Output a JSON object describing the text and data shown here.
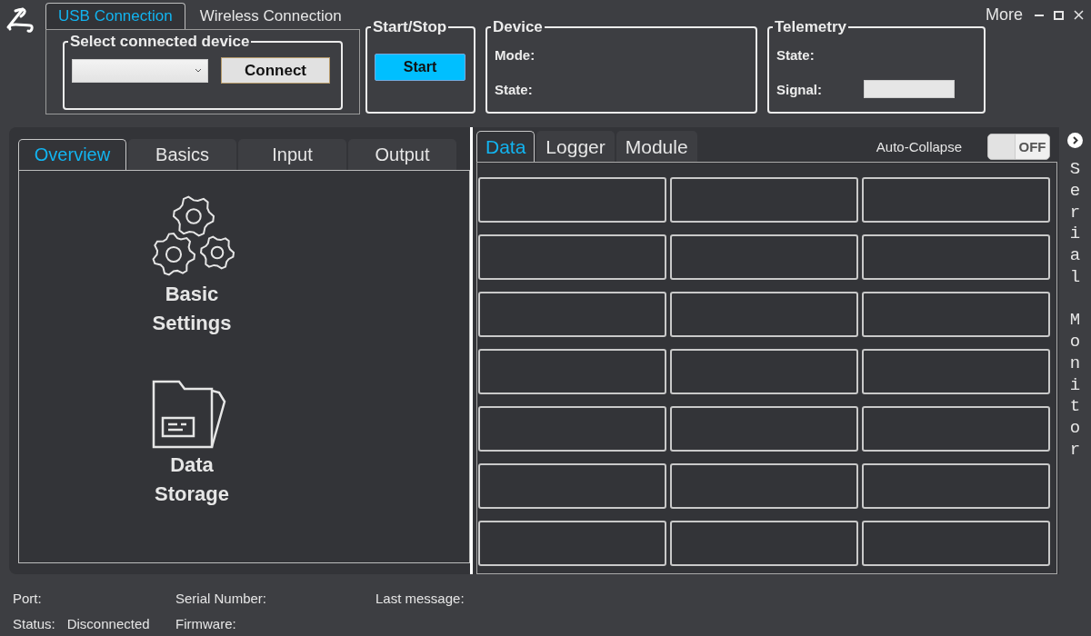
{
  "app_tabs": [
    {
      "label": "USB Connection",
      "selected": true
    },
    {
      "label": "Wireless Connection",
      "selected": false
    }
  ],
  "connect_group": {
    "title": "Select connected device",
    "button": "Connect"
  },
  "start_group": {
    "title": "Start/Stop",
    "button": "Start"
  },
  "device_group": {
    "title": "Device",
    "fields": [
      {
        "label": "Mode:"
      },
      {
        "label": "State:"
      }
    ]
  },
  "telemetry_group": {
    "title": "Telemetry",
    "state_label": "State:",
    "signal": {
      "label": "Signal:"
    }
  },
  "more_menu": "More",
  "settings_tabs": [
    {
      "label": "Overview",
      "selected": true
    },
    {
      "label": "Basics",
      "selected": false
    },
    {
      "label": "Input",
      "selected": false
    },
    {
      "label": "Output",
      "selected": false
    }
  ],
  "overview_items": [
    {
      "kind": "settings",
      "label": "Basic Settings"
    },
    {
      "kind": "storage",
      "label": "Data Storage"
    }
  ],
  "data_tabs": [
    {
      "label": "Data",
      "selected": true
    },
    {
      "label": "Logger",
      "selected": false
    },
    {
      "label": "Module",
      "selected": false
    }
  ],
  "auto_collapse": {
    "label": "Auto-Collapse",
    "on": false,
    "state_text": "OFF"
  },
  "data_tiles": [
    {
      "kind": "empty"
    },
    {
      "kind": "empty"
    },
    {
      "kind": "empty"
    },
    {
      "kind": "empty"
    },
    {
      "kind": "empty"
    },
    {
      "kind": "empty"
    },
    {
      "kind": "empty"
    },
    {
      "kind": "empty"
    },
    {
      "kind": "empty"
    },
    {
      "kind": "empty"
    },
    {
      "kind": "empty"
    },
    {
      "kind": "empty"
    },
    {
      "kind": "empty"
    },
    {
      "kind": "empty"
    },
    {
      "kind": "empty"
    },
    {
      "kind": "empty"
    },
    {
      "kind": "empty"
    },
    {
      "kind": "empty"
    },
    {
      "kind": "empty"
    },
    {
      "kind": "empty"
    },
    {
      "kind": "empty"
    }
  ],
  "serial_monitor": "Serial Monitor",
  "status_bar": [
    {
      "label": "Port:"
    },
    {
      "label": "Serial Number:"
    },
    {
      "label": "Last message:"
    },
    {
      "label": "Status:",
      "value": "Disconnected"
    },
    {
      "label": "Firmware:"
    }
  ]
}
